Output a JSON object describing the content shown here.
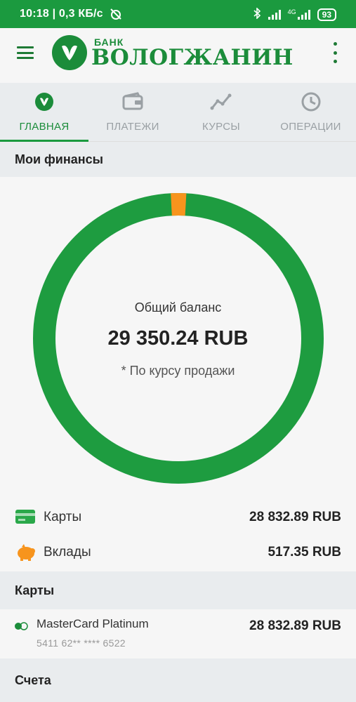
{
  "status": {
    "time_speed": "10:18 | 0,3 КБ/с",
    "battery": "93",
    "net_label": "4G",
    "icons": [
      "alarm-off-icon",
      "bluetooth-icon",
      "signal-icon",
      "battery-icon"
    ]
  },
  "header": {
    "bank_small": "БАНК",
    "bank_name": "ВОЛОГЖАНИН",
    "icons": [
      "menu-icon",
      "more-vertical-icon"
    ]
  },
  "tabs": [
    {
      "label": "ГЛАВНАЯ",
      "icon": "bank-logo-icon",
      "active": true
    },
    {
      "label": "ПЛАТЕЖИ",
      "icon": "wallet-icon",
      "active": false
    },
    {
      "label": "КУРСЫ",
      "icon": "chart-line-icon",
      "active": false
    },
    {
      "label": "ОПЕРАЦИИ",
      "icon": "clock-icon",
      "active": false
    }
  ],
  "finances": {
    "title": "Мои финансы",
    "balance_label": "Общий баланс",
    "balance_value": "29 350.24 RUB",
    "note": "* По курсу продажи",
    "donut_share": {
      "cards": 28832.89,
      "deposits": 517.35
    },
    "colors": {
      "cards": "#1e9c40",
      "deposits": "#f7941d"
    }
  },
  "summary": [
    {
      "label": "Карты",
      "value": "28 832.89 RUB",
      "icon": "card-icon"
    },
    {
      "label": "Вклады",
      "value": "517.35 RUB",
      "icon": "piggy-bank-icon"
    }
  ],
  "cards_section": {
    "title": "Карты",
    "items": [
      {
        "name": "MasterCard Platinum",
        "number": "5411 62** **** 6522",
        "value": "28 832.89 RUB",
        "icon": "mastercard-icon"
      }
    ]
  },
  "accounts_section": {
    "title": "Счета"
  }
}
